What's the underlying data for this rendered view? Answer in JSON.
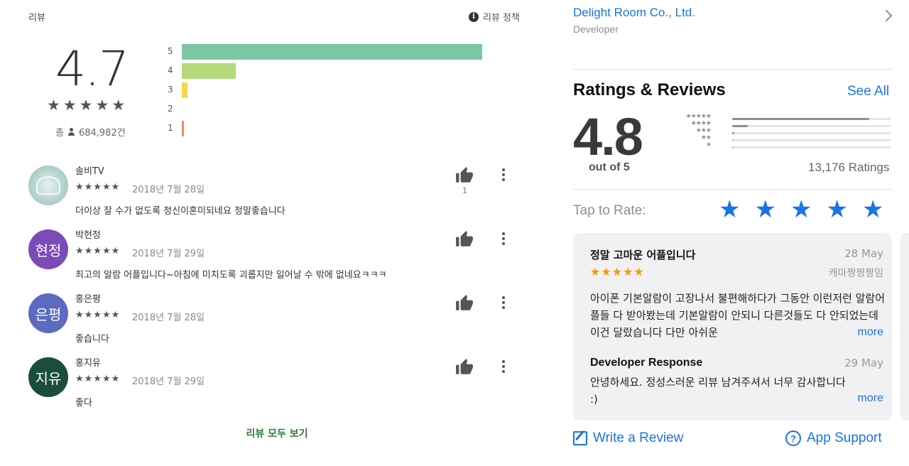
{
  "play_store": {
    "section_title": "리뷰",
    "policy_label": "리뷰 정책",
    "average_rating": "4.7",
    "average_stars": "★★★★★",
    "total_prefix": "총",
    "total_count": "684,982건",
    "histogram": [
      {
        "label": "5",
        "fraction": 1.0,
        "color": "#7bc8a4"
      },
      {
        "label": "4",
        "fraction": 0.18,
        "color": "#b4d97a"
      },
      {
        "label": "3",
        "fraction": 0.018,
        "color": "#f9d648"
      },
      {
        "label": "2",
        "fraction": 0.0,
        "color": "#f7b851"
      },
      {
        "label": "1",
        "fraction": 0.006,
        "color": "#f3866c"
      }
    ],
    "reviews": [
      {
        "avatar_text": "",
        "avatar_color": "",
        "name": "솔비TV",
        "stars": "★★★★★",
        "date": "2018년 7월 28일",
        "text": "더이상 잘 수가 없도록 정신이혼미되네요 정말좋습니다",
        "helpful_count": "1"
      },
      {
        "avatar_text": "현정",
        "avatar_color": "#7b4bb8",
        "name": "박현정",
        "stars": "★★★★★",
        "date": "2018년 7월 29일",
        "text": "최고의 알람 어플입니다~아침에 미치도록 괴롭지만 일어날 수 밖에 없네요ㅋㅋㅋ",
        "helpful_count": ""
      },
      {
        "avatar_text": "은평",
        "avatar_color": "#5c6bc0",
        "name": "홍은평",
        "stars": "★★★★★",
        "date": "2018년 7월 28일",
        "text": "좋습니다",
        "helpful_count": ""
      },
      {
        "avatar_text": "지유",
        "avatar_color": "#1b4d3e",
        "name": "홍지유",
        "stars": "★★★★★",
        "date": "2018년 7월 29일",
        "text": "좋다",
        "helpful_count": ""
      }
    ],
    "see_all_label": "리뷰 모두 보기"
  },
  "app_store": {
    "developer_name": "Delight Room Co., Ltd.",
    "developer_role": "Developer",
    "section_title": "Ratings & Reviews",
    "see_all_label": "See All",
    "average_rating": "4.8",
    "out_of_label": "out of 5",
    "ratings_count": "13,176 Ratings",
    "histogram": [
      {
        "stars": "★★★★★",
        "fraction": 0.86
      },
      {
        "stars": "★★★★",
        "fraction": 0.1
      },
      {
        "stars": "★★★",
        "fraction": 0.015
      },
      {
        "stars": "★★",
        "fraction": 0.005
      },
      {
        "stars": "★",
        "fraction": 0.005
      }
    ],
    "tap_to_rate_label": "Tap to Rate:",
    "tap_stars": [
      "★",
      "★",
      "★",
      "★",
      "★"
    ],
    "review_card": {
      "title": "정말 고마운 어플입니다",
      "date": "28 May",
      "stars": "★★★★★",
      "author": "캐마짱짱짱임",
      "body": "아이폰 기본알람이 고장나서 불편해하다가 그동안 이런저런 알람어플들 다 받아봤는데 기본알람이 안되니 다른것들도 다 안되었는데 이건 달랐습니다 다만 아쉬운",
      "more_label": "more",
      "response_title": "Developer Response",
      "response_date": "29 May",
      "response_body": "안녕하세요. 정성스러운 리뷰 남겨주셔서 너무 감사합니다 :)",
      "response_more_label": "more"
    },
    "write_review_label": "Write a Review",
    "app_support_label": "App Support",
    "accent_color": "#1a73e8"
  }
}
